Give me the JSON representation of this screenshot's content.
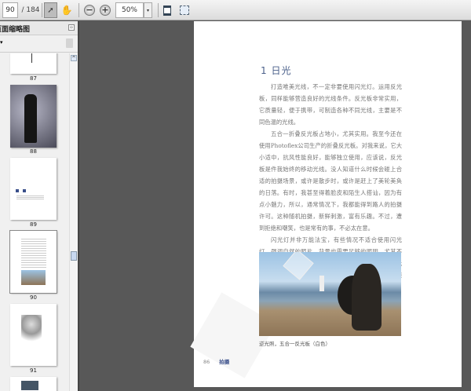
{
  "toolbar": {
    "page_current": "90",
    "page_total": "/ 184",
    "zoom": "50%",
    "zoom_dropdown": "▾"
  },
  "panel": {
    "title": "页面缩略图",
    "options": "▾",
    "close": "▫",
    "scroll_up": "^",
    "thumbnails": [
      {
        "label": "87"
      },
      {
        "label": "88"
      },
      {
        "label": "89"
      },
      {
        "label": "90"
      },
      {
        "label": "91"
      }
    ]
  },
  "document": {
    "heading": "1 日光",
    "paragraphs": [
      "打造唯美光线，不一定非要使用闪光灯。运用反光板，同样能够营造良好的光线条件。反光板非常实用，它质量轻，便于携带，可制造各种不同光线，主要是不同色温的光线。",
      "五合一折叠反光板占地小，尤其实用。我至今还在使用Photoflex公司生产的折叠反光板。对我来说，它大小适中，抗风性能良好，能够独立使用，应该说，反光板是件我始终的移动光线。没人知道什么时候会碰上合适的拍摄场景，或许是散步时，或许是赶上了美轮美奂的日落。有时，我甚至得着脸皮和陌生人搭讪，因为有点小魅力，所以，通常情况下，我都能得到路人的拍摄许可。这种随机拍摄，新鲜刺激，富有乐趣。不过，遭到拒绝和嘲笑，也是常有的事，不必太在意。",
      "闪光灯并非万能法宝，有些情况不适合使用闪光灯。强调自然的照片，背景也需要足够的照明，尤其不能使用闪光灯。反光板能够帮助摄影师充分利用现有光线。逆光拍摄，容易曝光不足，反光板将光线引向模特，就不再会曝光不足。另外，反光板还有一个优点，不受闪光时间限制，能够拍出优美的动感照片。"
    ],
    "caption": "逆光照，五合一反光板（白色）",
    "page_number": "86",
    "section": "拍摄"
  }
}
